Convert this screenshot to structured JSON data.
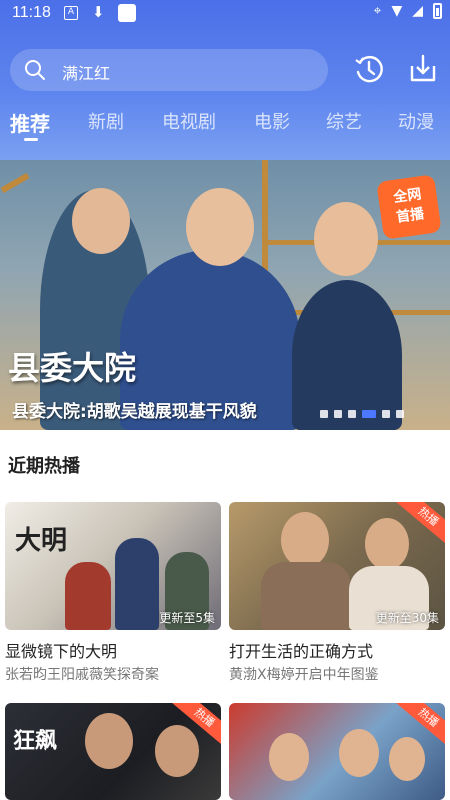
{
  "status_bar": {
    "time": "11:18"
  },
  "search": {
    "placeholder": "满江红"
  },
  "tabs": [
    {
      "label": "推荐"
    },
    {
      "label": "新剧"
    },
    {
      "label": "电视剧"
    },
    {
      "label": "电影"
    },
    {
      "label": "综艺"
    },
    {
      "label": "动漫"
    }
  ],
  "banner": {
    "title": "县委大院",
    "subtitle": "县委大院:胡歌吴越展现基干风貌",
    "badge": "全网\n首播",
    "page_count": 6,
    "active_index": 3
  },
  "section": {
    "title": "近期热播"
  },
  "cards": [
    {
      "title": "显微镜下的大明",
      "desc": "张若昀王阳戚薇笑探奇案",
      "update": "更新至5集",
      "hot": ""
    },
    {
      "title": "打开生活的正确方式",
      "desc": "黄渤X梅婷开启中年图鉴",
      "update": "更新至30集",
      "hot": "热播"
    },
    {
      "title": "",
      "desc": "",
      "update": "",
      "hot": "热播"
    },
    {
      "title": "",
      "desc": "",
      "update": "",
      "hot": "热播"
    }
  ],
  "colors": {
    "header": "#4b6fe8",
    "accent": "#4b78ff",
    "hot": "#ff5a3c",
    "badge": "#ff6a2a"
  }
}
